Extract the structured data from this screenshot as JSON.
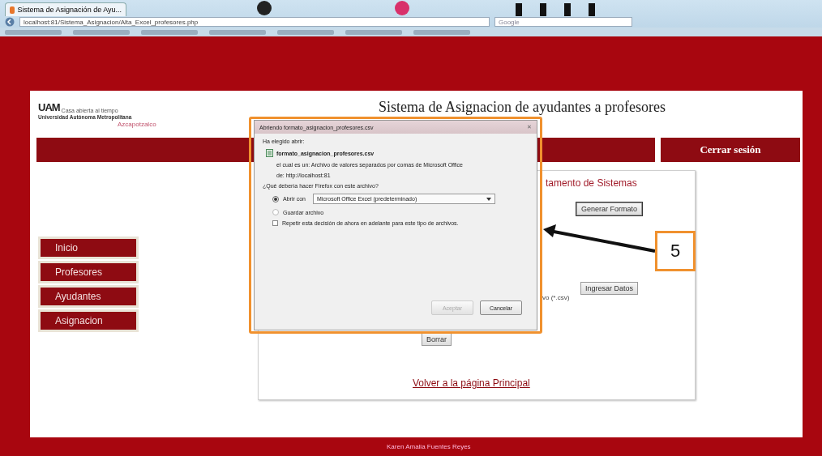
{
  "browser": {
    "tab_title": "Sistema de Asignación de Ayu...",
    "url": "localhost:81/Sistema_Asignacion/Alta_Excel_profesores.php",
    "search_placeholder": "Google"
  },
  "header": {
    "logo_letters": "UAM",
    "logo_tagline": "Casa abierta al tiempo",
    "university": "Universidad Autónoma Metropolitana",
    "campus": "Azcapotzalco",
    "title": "Sistema de Asignacion de ayudantes a profesores"
  },
  "nav": {
    "logout": "Cerrar sesión"
  },
  "sidebar": {
    "items": [
      {
        "label": "Inicio",
        "selected": false
      },
      {
        "label": "Profesores",
        "selected": false
      },
      {
        "label": "Ayudantes",
        "selected": false
      },
      {
        "label": "Asignacion",
        "selected": false
      }
    ]
  },
  "content": {
    "heading": "tamento de Sistemas",
    "generate_button": "Generar Formato",
    "upload_button": "Ingresar Datos",
    "file_hint": "vo (*.csv)",
    "delete_button": "Borrar",
    "back_link": "Volver a la página Principal"
  },
  "dialog": {
    "title": "Abriendo formato_asignacion_profesores.csv",
    "close": "✕",
    "intro": "Ha elegido abrir:",
    "file_name": "formato_asignacion_profesores.csv",
    "file_type": "el cual es un: Archivo de valores separados por comas de Microsoft Office",
    "source": "de: http://localhost:81",
    "question": "¿Qué debería hacer Firefox con este archivo?",
    "options": [
      {
        "label": "Abrir con",
        "selected": true
      },
      {
        "label": "Guardar archivo",
        "selected": false
      }
    ],
    "app_select": "Microsoft Office Excel (predeterminado)",
    "remember": {
      "label": "Repetir esta decisión de ahora en adelante para este tipo de archivos.",
      "checked": false
    },
    "buttons": [
      {
        "label": "Aceptar",
        "disabled": true
      },
      {
        "label": "Cancelar",
        "disabled": false
      }
    ]
  },
  "callout": {
    "number": "5"
  },
  "footer": {
    "author": "Karen Amalia Fuentes Reyes"
  }
}
